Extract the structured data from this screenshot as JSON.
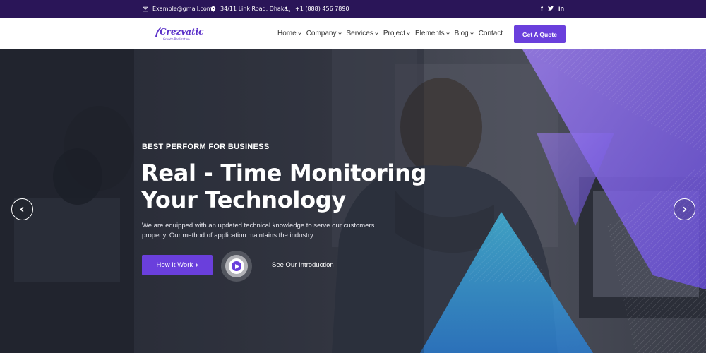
{
  "topbar": {
    "email": "Example@gmail.com",
    "address": "34/11 Link Road, Dhaka",
    "phone": "+1 (888) 456 7890",
    "email_icon": "envelope-icon",
    "address_icon": "map-pin-icon",
    "phone_icon": "phone-icon",
    "social": [
      {
        "name": "facebook-icon",
        "glyph": "f"
      },
      {
        "name": "twitter-icon",
        "glyph": "🐦"
      },
      {
        "name": "linkedin-icon",
        "glyph": "in"
      }
    ]
  },
  "header": {
    "logo_text": "Crezvatic",
    "logo_tagline": "Growth Realization",
    "nav": [
      {
        "label": "Home",
        "dropdown": true
      },
      {
        "label": "Company",
        "dropdown": true
      },
      {
        "label": "Services",
        "dropdown": true
      },
      {
        "label": "Project",
        "dropdown": true
      },
      {
        "label": "Elements",
        "dropdown": true
      },
      {
        "label": "Blog",
        "dropdown": true
      },
      {
        "label": "Contact",
        "dropdown": false
      }
    ],
    "cta_label": "Get A Quote"
  },
  "hero": {
    "eyebrow": "BEST PERFORM FOR BUSINESS",
    "headline_line1": "Real - Time Monitoring",
    "headline_line2": "Your Technology",
    "description": "We are equipped with an updated technical knowledge to serve our customers properly. Our method of application maintains the industry.",
    "primary_button": "How It Work",
    "primary_button_arrow": "›",
    "video_link": "See Our Introduction",
    "prev_icon": "chevron-left-icon",
    "next_icon": "chevron-right-icon"
  },
  "colors": {
    "topbar_bg": "#2a1558",
    "accent": "#6a3fdc",
    "header_bg": "#ffffff",
    "nav_text": "#333333"
  }
}
